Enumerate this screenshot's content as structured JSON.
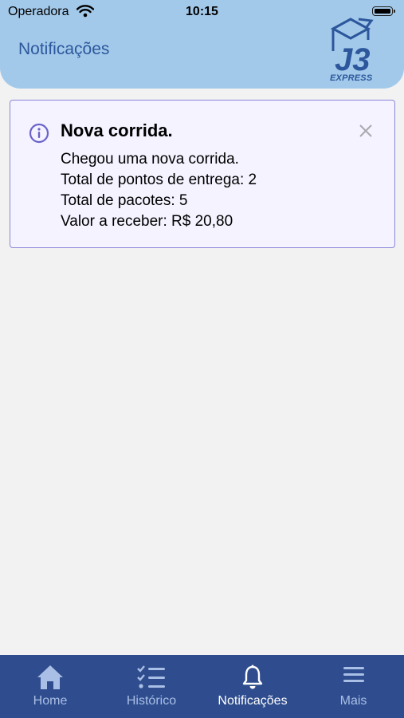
{
  "status_bar": {
    "carrier": "Operadora",
    "time": "10:15"
  },
  "header": {
    "title": "Notificações",
    "logo_text": "J3",
    "logo_subtext": "EXPRESS"
  },
  "notification": {
    "title": "Nova corrida.",
    "lines": [
      "Chegou uma nova corrida.",
      "Total de pontos de entrega: 2",
      "Total de pacotes: 5",
      "Valor a receber: R$ 20,80"
    ]
  },
  "tabs": [
    {
      "label": "Home",
      "icon": "home-icon",
      "active": false
    },
    {
      "label": "Histórico",
      "icon": "checklist-icon",
      "active": false
    },
    {
      "label": "Notificações",
      "icon": "bell-icon",
      "active": true
    },
    {
      "label": "Mais",
      "icon": "menu-icon",
      "active": false
    }
  ],
  "colors": {
    "header_bg": "#a3c9ea",
    "brand_blue": "#2c579c",
    "tabbar_bg": "#2f4d8e",
    "card_border": "#8b86d8",
    "card_bg": "#f4f3ff"
  }
}
